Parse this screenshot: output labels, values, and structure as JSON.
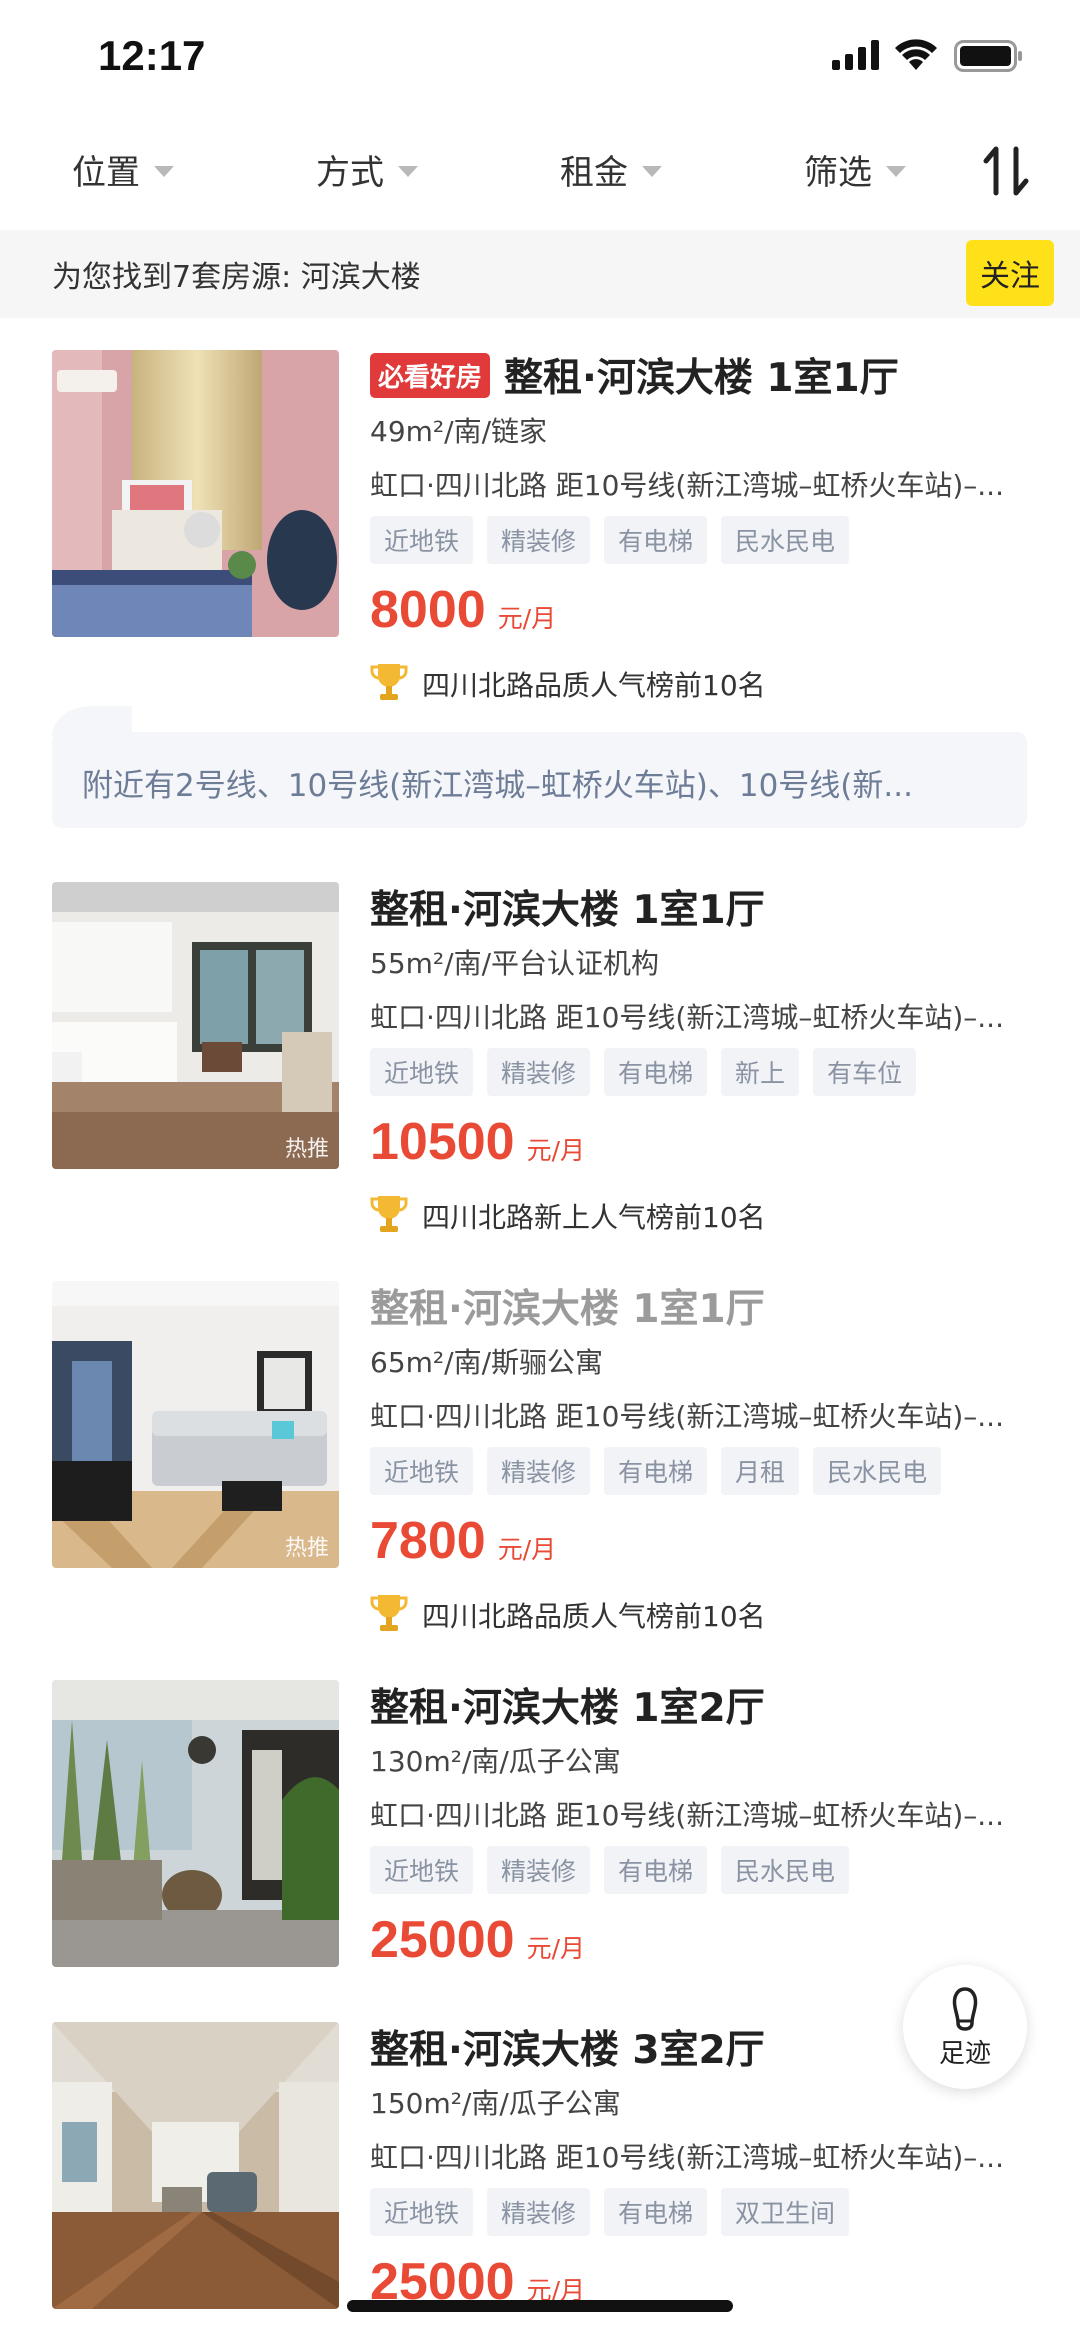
{
  "status_bar": {
    "time": "12:17"
  },
  "filters": {
    "items": [
      {
        "label": "位置"
      },
      {
        "label": "方式"
      },
      {
        "label": "租金"
      },
      {
        "label": "筛选"
      }
    ],
    "sort_icon": "sort-arrows-icon"
  },
  "result_bar": {
    "text": "为您找到7套房源: 河滨大楼",
    "follow_label": "关注"
  },
  "listings": [
    {
      "badge": "必看好房",
      "title": "整租·河滨大楼 1室1厅",
      "spec": "49m²/南/链家",
      "location": "虹口·四川北路 距10号线(新江湾城–虹桥火车站)–...",
      "tags": [
        "近地铁",
        "精装修",
        "有电梯",
        "民水民电"
      ],
      "price": "8000",
      "unit": "元/月",
      "rank": "四川北路品质人气榜前10名",
      "photo_badge": ""
    },
    {
      "badge": "",
      "title": "整租·河滨大楼 1室1厅",
      "spec": "55m²/南/平台认证机构",
      "location": "虹口·四川北路 距10号线(新江湾城–虹桥火车站)–...",
      "tags": [
        "近地铁",
        "精装修",
        "有电梯",
        "新上",
        "有车位"
      ],
      "price": "10500",
      "unit": "元/月",
      "rank": "四川北路新上人气榜前10名",
      "photo_badge": "热推"
    },
    {
      "badge": "",
      "title": "整租·河滨大楼 1室1厅",
      "spec": "65m²/南/斯骊公寓",
      "location": "虹口·四川北路 距10号线(新江湾城–虹桥火车站)–...",
      "tags": [
        "近地铁",
        "精装修",
        "有电梯",
        "月租",
        "民水民电"
      ],
      "price": "7800",
      "unit": "元/月",
      "rank": "四川北路品质人气榜前10名",
      "photo_badge": "热推"
    },
    {
      "badge": "",
      "title": "整租·河滨大楼 1室2厅",
      "spec": "130m²/南/瓜子公寓",
      "location": "虹口·四川北路 距10号线(新江湾城–虹桥火车站)–...",
      "tags": [
        "近地铁",
        "精装修",
        "有电梯",
        "民水民电"
      ],
      "price": "25000",
      "unit": "元/月",
      "rank": "",
      "photo_badge": ""
    },
    {
      "badge": "",
      "title": "整租·河滨大楼 3室2厅",
      "spec": "150m²/南/瓜子公寓",
      "location": "虹口·四川北路 距10号线(新江湾城–虹桥火车站)–...",
      "tags": [
        "近地铁",
        "精装修",
        "有电梯",
        "双卫生间"
      ],
      "price": "25000",
      "unit": "元/月",
      "rank": "",
      "photo_badge": ""
    }
  ],
  "nearby": {
    "text": "附近有2号线、10号线(新江湾城–虹桥火车站)、10号线(新..."
  },
  "footprint": {
    "label": "足迹",
    "icon": "footprint-icon"
  },
  "colors": {
    "price": "#e84a35",
    "follow_button": "#ffe11a",
    "must_see_badge": "#e03a3a",
    "tag_text": "#8a93a3",
    "nearby_text": "#6d7c97"
  }
}
